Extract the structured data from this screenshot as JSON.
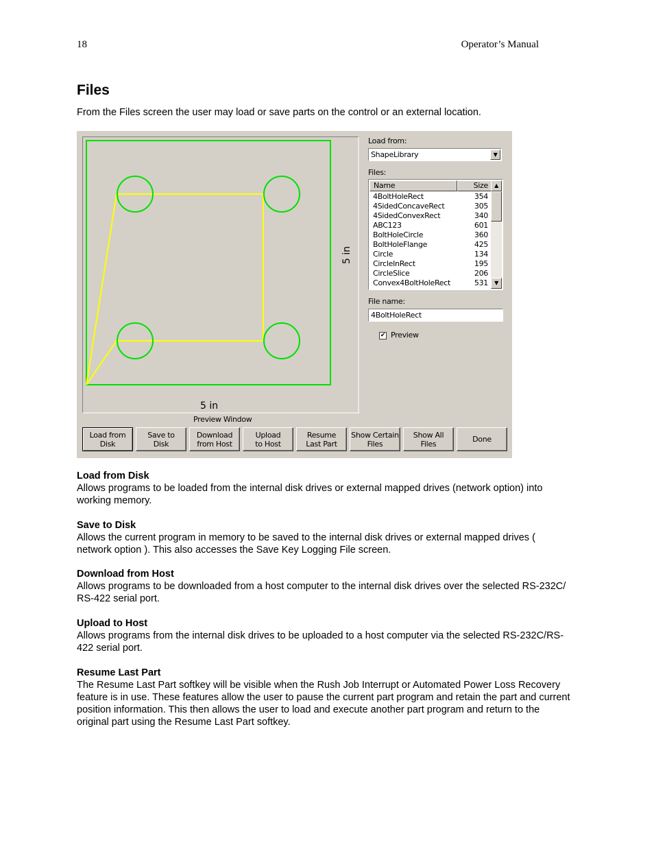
{
  "page_header": {
    "page_number": "18",
    "manual_title": "Operator’s Manual"
  },
  "section": {
    "title": "Files",
    "intro": "From the Files screen the user may load or save parts on the control or an external location."
  },
  "screen": {
    "preview": {
      "width_label": "5 in",
      "height_label": "5 in",
      "caption": "Preview Window",
      "outline_color": "#00e000",
      "path_color": "#ffff00"
    },
    "load_from": {
      "label": "Load from:",
      "value": "ShapeLibrary"
    },
    "files": {
      "label": "Files:",
      "columns": [
        "Name",
        "Size"
      ],
      "rows": [
        [
          "4BoltHoleRect",
          "354"
        ],
        [
          "4SidedConcaveRect",
          "305"
        ],
        [
          "4SidedConvexRect",
          "340"
        ],
        [
          "ABC123",
          "601"
        ],
        [
          "BoltHoleCircle",
          "360"
        ],
        [
          "BoltHoleFlange",
          "425"
        ],
        [
          "Circle",
          "134"
        ],
        [
          "CircleInRect",
          "195"
        ],
        [
          "CircleSlice",
          "206"
        ],
        [
          "Convex4BoltHoleRect",
          "531"
        ]
      ]
    },
    "file_name": {
      "label": "File name:",
      "value": "4BoltHoleRect"
    },
    "preview_checkbox": {
      "label": "Preview",
      "checked": true
    },
    "softkeys": {
      "load": [
        "Load from",
        "Disk"
      ],
      "save": [
        "Save to",
        "Disk"
      ],
      "download": [
        "Download",
        "from Host"
      ],
      "upload": [
        "Upload",
        "to Host"
      ],
      "resume": [
        "Resume",
        "Last Part"
      ],
      "show_certain": [
        "Show Certain",
        "Files"
      ],
      "show_all": [
        "Show All",
        "Files"
      ],
      "done": [
        "Done"
      ]
    }
  },
  "descriptions": [
    {
      "heading": "Load from Disk",
      "text": "Allows programs to be loaded from the internal disk drives or external mapped drives (network option) into working memory."
    },
    {
      "heading": "Save to Disk",
      "text": "Allows the current program in memory to be saved to the internal disk drives or external mapped drives ( network option ).  This also accesses the Save Key Logging File screen."
    },
    {
      "heading": "Download from Host",
      "text": "Allows programs to be downloaded from a host computer to the internal disk drives over the selected RS-232C/ RS-422 serial port."
    },
    {
      "heading": "Upload to Host",
      "text": "Allows programs from the internal disk drives to be uploaded to a host computer via the selected RS-232C/RS-422 serial port."
    },
    {
      "heading": "Resume Last Part",
      "text": "The Resume Last Part softkey will be visible when the Rush Job Interrupt or Automated Power Loss Recovery feature is in use.  These features allow the user to pause the current part program and retain the part and current position information.  This then allows the user to load and execute another part program and return to the original part using the Resume Last Part softkey."
    }
  ]
}
